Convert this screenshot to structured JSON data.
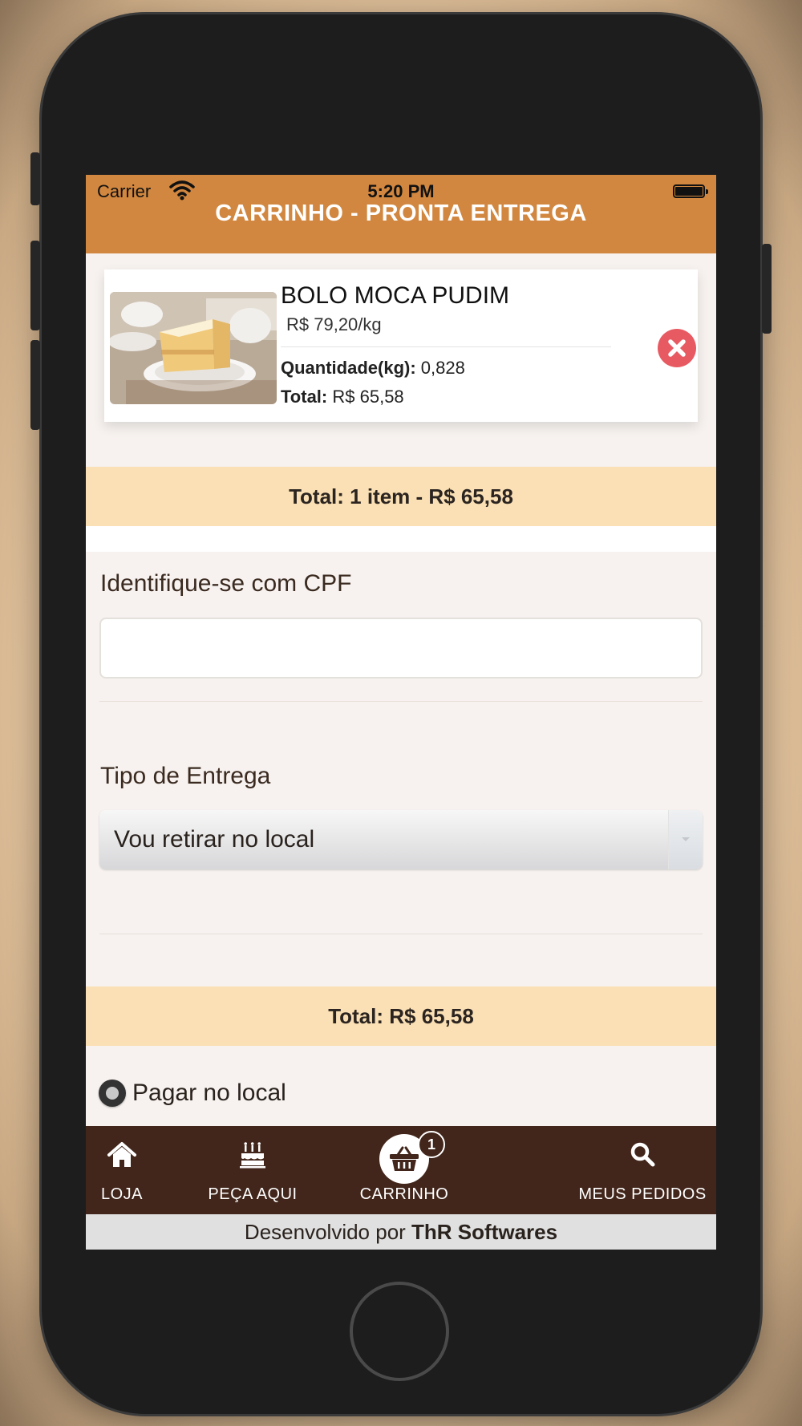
{
  "status_bar": {
    "carrier": "Carrier",
    "time": "5:20 PM"
  },
  "header": {
    "title": "CARRINHO - PRONTA ENTREGA"
  },
  "cart_item": {
    "name": "BOLO MOCA PUDIM",
    "price": "R$ 79,20/kg",
    "qty_label": "Quantidade(kg):",
    "qty_value": "0,828",
    "total_label": "Total:",
    "total_value": "R$ 65,58"
  },
  "summary": {
    "items_total": "Total: 1 item - R$ 65,58"
  },
  "form": {
    "cpf_label": "Identifique-se com CPF",
    "cpf_value": "",
    "delivery_label": "Tipo de Entrega",
    "delivery_selected": "Vou retirar no local"
  },
  "order_total": "Total: R$ 65,58",
  "payment": {
    "option": "Pagar no local"
  },
  "tabs": [
    {
      "label": "LOJA",
      "icon": "home-icon"
    },
    {
      "label": "PEÇA AQUI",
      "icon": "cake-icon"
    },
    {
      "label": "CARRINHO",
      "icon": "basket-icon",
      "badge": "1"
    },
    {
      "label": "MEUS PEDIDOS",
      "icon": "search-icon"
    }
  ],
  "footer": {
    "prefix": "Desenvolvido por ",
    "brand": "ThR Softwares"
  },
  "colors": {
    "header": "#d1873f",
    "band": "#fae0b4",
    "tabbar": "#42261b",
    "remove": "#e85a62"
  }
}
